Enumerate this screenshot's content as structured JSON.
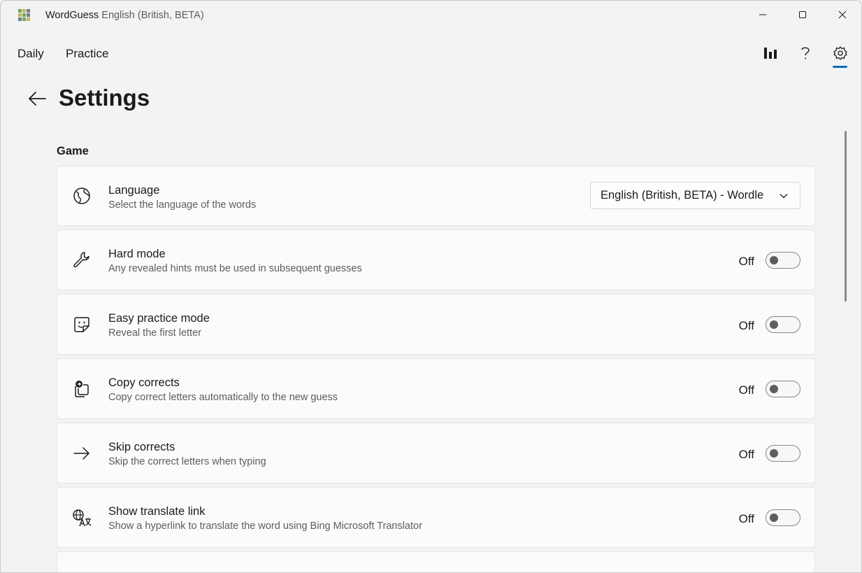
{
  "window": {
    "app_name": "WordGuess",
    "subtitle": "English (British, BETA)",
    "logo_colors": [
      "#6aaa64",
      "#c9b458",
      "#787c7e",
      "#c9b458",
      "#6aaa64",
      "#787c7e",
      "#787c7e",
      "#6aaa64",
      "#c9b458"
    ]
  },
  "nav": {
    "items": [
      {
        "label": "Daily"
      },
      {
        "label": "Practice"
      }
    ],
    "icons": [
      "statistics-icon",
      "help-icon",
      "settings-icon"
    ],
    "accent": "#0f6cbd"
  },
  "page": {
    "title": "Settings",
    "section": "Game"
  },
  "settings": [
    {
      "title": "Language",
      "desc": "Select the language of the words",
      "icon": "globe-icon",
      "control": "dropdown",
      "value": "English (British, BETA) - Wordle"
    },
    {
      "title": "Hard mode",
      "desc": "Any revealed hints must be used in subsequent guesses",
      "icon": "wrench-icon",
      "control": "toggle",
      "state": "Off"
    },
    {
      "title": "Easy practice mode",
      "desc": "Reveal the first letter",
      "icon": "sticker-icon",
      "control": "toggle",
      "state": "Off"
    },
    {
      "title": "Copy corrects",
      "desc": "Copy correct letters automatically to the new guess",
      "icon": "copy-arrow-icon",
      "control": "toggle",
      "state": "Off"
    },
    {
      "title": "Skip corrects",
      "desc": "Skip the correct letters when typing",
      "icon": "arrow-right-icon",
      "control": "toggle",
      "state": "Off"
    },
    {
      "title": "Show translate link",
      "desc": "Show a hyperlink to translate the word using Bing Microsoft Translator",
      "icon": "translate-icon",
      "control": "toggle",
      "state": "Off"
    }
  ]
}
